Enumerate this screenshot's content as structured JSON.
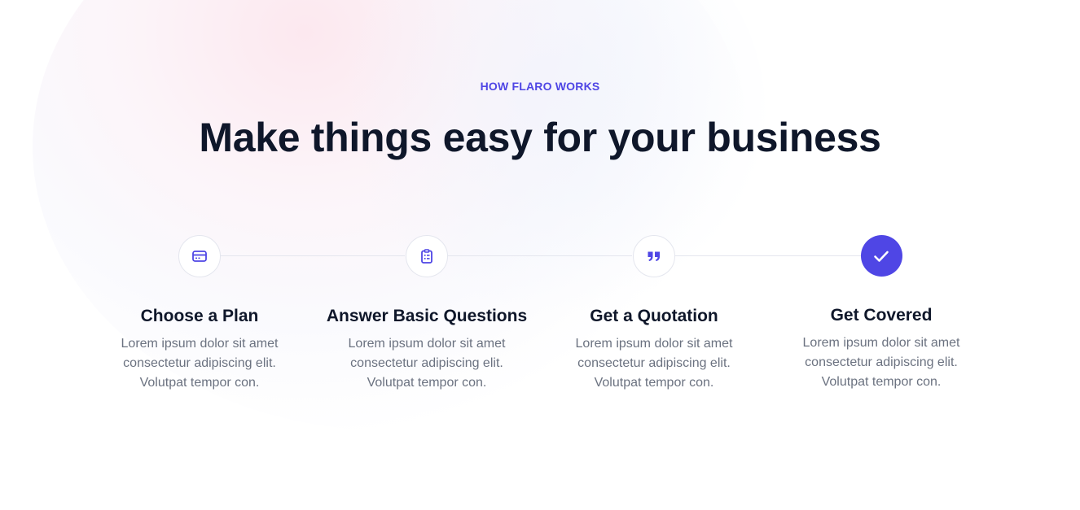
{
  "section": {
    "eyebrow": "HOW FLARO WORKS",
    "headline": "Make things easy for your business"
  },
  "steps": [
    {
      "icon": "credit-card-icon",
      "title": "Choose a Plan",
      "description": "Lorem ipsum dolor sit amet consectetur adipiscing elit. Volutpat tempor con.",
      "completed": false
    },
    {
      "icon": "clipboard-list-icon",
      "title": "Answer Basic Questions",
      "description": "Lorem ipsum dolor sit amet consectetur adipiscing elit. Volutpat tempor con.",
      "completed": false
    },
    {
      "icon": "quote-icon",
      "title": "Get a Quotation",
      "description": "Lorem ipsum dolor sit amet consectetur adipiscing elit. Volutpat tempor con.",
      "completed": false
    },
    {
      "icon": "check-icon",
      "title": "Get Covered",
      "description": "Lorem ipsum dolor sit amet consectetur adipiscing elit. Volutpat tempor con.",
      "completed": true
    }
  ],
  "colors": {
    "accent": "#4f46e5",
    "heading": "#0f172a",
    "body_text": "#6b7280",
    "connector": "#e4e6ee"
  }
}
